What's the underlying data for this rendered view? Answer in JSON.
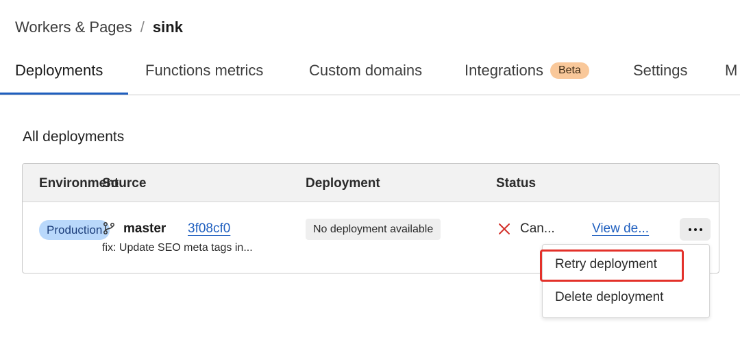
{
  "breadcrumb": {
    "parent": "Workers & Pages",
    "separator": "/",
    "current": "sink"
  },
  "tabs": [
    {
      "label": "Deployments",
      "active": true
    },
    {
      "label": "Functions metrics"
    },
    {
      "label": "Custom domains"
    },
    {
      "label": "Integrations",
      "badge": "Beta"
    },
    {
      "label": "Settings"
    },
    {
      "label": "M"
    }
  ],
  "section": {
    "title": "All deployments"
  },
  "table": {
    "headers": [
      "Environment",
      "Source",
      "Deployment",
      "Status"
    ],
    "rows": [
      {
        "environment": "Production",
        "branch": "master",
        "commit": "3f08cf0",
        "commit_message": "fix: Update SEO meta tags in...",
        "deployment": "No deployment available",
        "status": "Can...",
        "view_link": "View de..."
      }
    ]
  },
  "menu": {
    "items": [
      "Retry deployment",
      "Delete deployment"
    ]
  },
  "colors": {
    "accent": "#1f5fbf",
    "badge_bg": "#f9c89a",
    "env_pill_bg": "#b9d8fb",
    "status_failed": "#d3302a",
    "highlight": "#e3312a"
  },
  "icons": {
    "branch": "git-branch-icon",
    "status": "x-icon",
    "more": "more-horizontal-icon"
  }
}
